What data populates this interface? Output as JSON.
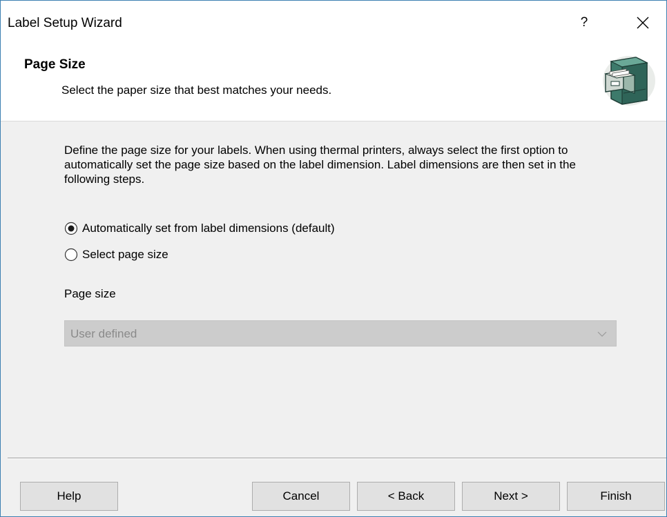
{
  "window": {
    "title": "Label Setup Wizard",
    "help_glyph": "?",
    "close_icon": "close-icon"
  },
  "header": {
    "title": "Page Size",
    "subtitle": "Select the paper size that best matches your needs.",
    "art_icon": "file-cabinet-icon"
  },
  "body": {
    "description": "Define the page size for your labels. When using thermal printers, always select the first option to automatically set the page size based on the label dimension. Label dimensions are then set in the following steps.",
    "options": [
      {
        "label": "Automatically set from label dimensions (default)",
        "selected": true
      },
      {
        "label": "Select page size",
        "selected": false
      }
    ],
    "page_size_label": "Page size",
    "page_size_select": {
      "value": "User defined",
      "enabled": false
    }
  },
  "footer": {
    "help": "Help",
    "cancel": "Cancel",
    "back": "< Back",
    "next": "Next >",
    "finish": "Finish"
  },
  "colors": {
    "title_border": "#3c7fb1",
    "header_bg": "#ffffff",
    "dialog_bg": "#f0f0f0",
    "disabled_select_bg": "#cccccc",
    "disabled_text": "#8a8a8a"
  }
}
